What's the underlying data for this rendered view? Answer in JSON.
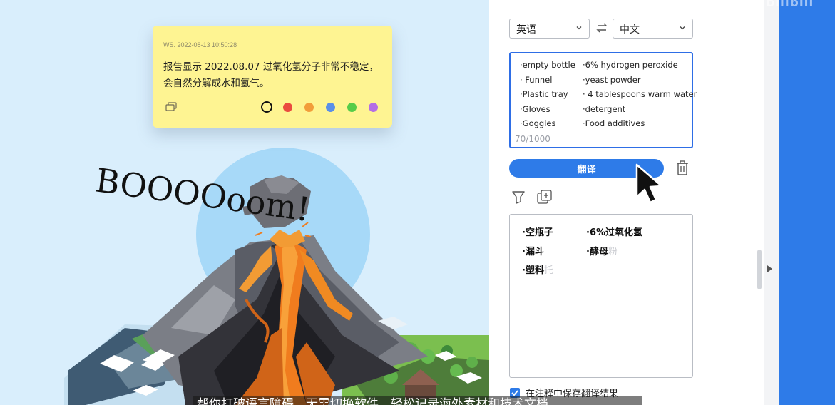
{
  "note": {
    "timestamp": "WS. 2022-08-13 10:50:28",
    "text": "报告显示  2022.08.07 过氧化氢分子非常不稳定，会自然分解成水和氢气。",
    "colors": [
      "#fef492",
      "#ea4b3f",
      "#f29d3a",
      "#5a8fe8",
      "#56cc49",
      "#b46ee5"
    ]
  },
  "illustration": {
    "boom_text": "BOOOOoom!"
  },
  "panel": {
    "source_lang": "英语",
    "target_lang": "中文",
    "source_items": [
      "·empty bottle",
      "· Funnel",
      "·Plastic tray",
      "·Gloves",
      "·Goggles",
      "·6% hydrogen peroxide",
      "·yeast powder",
      "· 4 tablespoons warm water",
      "·detergent",
      "·Food additives"
    ],
    "char_count": "70/1000",
    "translate_label": "翻译",
    "output_items": [
      "·空瓶子",
      "·漏斗",
      "·塑料",
      "·6%过氧化氢",
      "·酵母"
    ],
    "output_tail": [
      "托",
      "粉"
    ],
    "save_label": "在注释中保存翻译结果"
  },
  "watermark": "bilibili",
  "subtitle": "帮你打破语言障碍，无需切换软件，轻松记录海外素材和技术文档"
}
